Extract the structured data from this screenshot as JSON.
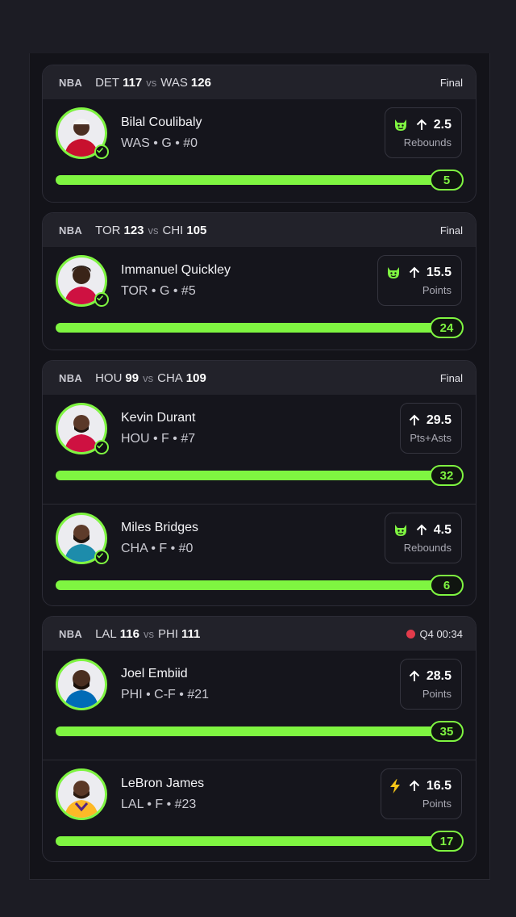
{
  "accent_color": "#7ff541",
  "live_color": "#e33b4b",
  "cards": [
    {
      "league": "NBA",
      "away_team": "DET",
      "away_score": "117",
      "vs": "vs",
      "home_team": "WAS",
      "home_score": "126",
      "status": "Final",
      "live": false,
      "players": [
        {
          "name": "Bilal Coulibaly",
          "meta": "WAS • G • #0",
          "emoji_icon": "devil-emoji-icon",
          "direction": "up-arrow-icon",
          "line": "2.5",
          "stat": "Rebounds",
          "actual": "5",
          "progress_pct": 100,
          "jersey_color": "#c8102e"
        }
      ]
    },
    {
      "league": "NBA",
      "away_team": "TOR",
      "away_score": "123",
      "vs": "vs",
      "home_team": "CHI",
      "home_score": "105",
      "status": "Final",
      "live": false,
      "players": [
        {
          "name": "Immanuel Quickley",
          "meta": "TOR • G • #5",
          "emoji_icon": "devil-emoji-icon",
          "direction": "up-arrow-icon",
          "line": "15.5",
          "stat": "Points",
          "actual": "24",
          "progress_pct": 100,
          "jersey_color": "#ce1141"
        }
      ]
    },
    {
      "league": "NBA",
      "away_team": "HOU",
      "away_score": "99",
      "vs": "vs",
      "home_team": "CHA",
      "home_score": "109",
      "status": "Final",
      "live": false,
      "players": [
        {
          "name": "Kevin Durant",
          "meta": "HOU • F • #7",
          "emoji_icon": "",
          "direction": "up-arrow-icon",
          "line": "29.5",
          "stat": "Pts+Asts",
          "actual": "32",
          "progress_pct": 100,
          "jersey_color": "#ce1141"
        },
        {
          "name": "Miles Bridges",
          "meta": "CHA • F • #0",
          "emoji_icon": "devil-emoji-icon",
          "direction": "up-arrow-icon",
          "line": "4.5",
          "stat": "Rebounds",
          "actual": "6",
          "progress_pct": 100,
          "jersey_color": "#1d8cab"
        }
      ]
    },
    {
      "league": "NBA",
      "away_team": "LAL",
      "away_score": "116",
      "vs": "vs",
      "home_team": "PHI",
      "home_score": "111",
      "status": "Q4 00:34",
      "live": true,
      "players": [
        {
          "name": "Joel Embiid",
          "meta": "PHI • C-F • #21",
          "emoji_icon": "",
          "direction": "up-arrow-icon",
          "line": "28.5",
          "stat": "Points",
          "actual": "35",
          "progress_pct": 100,
          "jersey_color": "#006bb6"
        },
        {
          "name": "LeBron James",
          "meta": "LAL • F • #23",
          "emoji_icon": "lightning-bolt-icon",
          "direction": "up-arrow-icon",
          "line": "16.5",
          "stat": "Points",
          "actual": "17",
          "progress_pct": 100,
          "jersey_color": "#fdb927"
        }
      ]
    }
  ]
}
